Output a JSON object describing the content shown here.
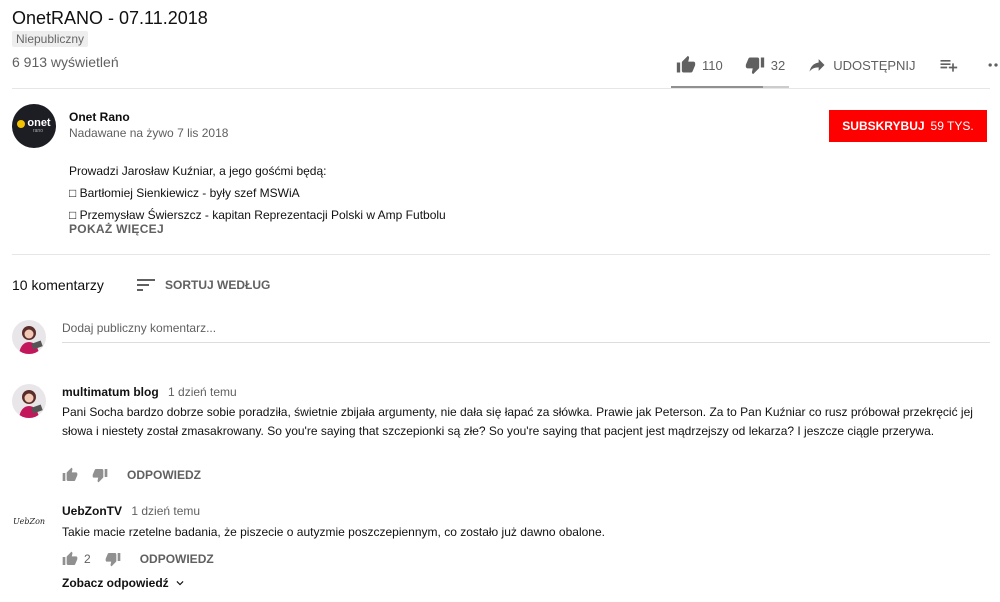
{
  "video": {
    "title": "OnetRANO - 07.11.2018",
    "privacy_badge": "Niepubliczny",
    "views": "6 913 wyświetleń",
    "likes": "110",
    "dislikes": "32",
    "share_label": "UDOSTĘPNIJ",
    "like_ratio": 0.78
  },
  "channel": {
    "logo_text": "onet",
    "logo_sub": "rano",
    "name": "Onet Rano",
    "date": "Nadawane na żywo 7 lis 2018",
    "subscribe_label": "SUBSKRYBUJ",
    "subscriber_count": "59 TYS."
  },
  "description": {
    "line1": "Prowadzi Jarosław Kuźniar, a jego gośćmi będą:",
    "line2": "□ Bartłomiej Sienkiewicz - były szef MSWiA",
    "line3": "□ Przemysław Świerszcz - kapitan Reprezentacji Polski w Amp Futbolu",
    "show_more": "POKAŻ WIĘCEJ"
  },
  "comments_header": {
    "count": "10 komentarzy",
    "sort_label": "SORTUJ WEDŁUG"
  },
  "add_comment": {
    "placeholder": "Dodaj publiczny komentarz..."
  },
  "comments": [
    {
      "author": "multimatum blog",
      "time": "1 dzień temu",
      "text": "Pani Socha bardzo dobrze sobie poradziła, świetnie zbijała argumenty, nie dała się łapać za słówka. Prawie jak Peterson. Za to Pan Kuźniar co rusz próbował przekręcić jej słowa i niestety został zmasakrowany. So you're saying that szczepionki są złe? So you're saying that pacjent jest mądrzejszy od lekarza? I jeszcze ciągle przerywa.",
      "likes": "",
      "reply_label": "ODPOWIEDZ"
    },
    {
      "author": "UebZonTV",
      "avatar_text": "UebZon",
      "time": "1 dzień temu",
      "text": "Takie macie rzetelne badania, że piszecie o autyzmie poszczepiennym, co zostało już dawno obalone.",
      "likes": "2",
      "reply_label": "ODPOWIEDZ",
      "view_replies": "Zobacz odpowiedź"
    }
  ],
  "icons": {
    "like": "thumb-up-icon",
    "dislike": "thumb-down-icon",
    "share": "share-icon",
    "add_to_playlist": "playlist-add-icon",
    "more": "more-icon",
    "sort": "sort-icon",
    "chevron": "chevron-down-icon"
  },
  "colors": {
    "subscribe": "#ff0000",
    "secondary_text": "#606060"
  }
}
